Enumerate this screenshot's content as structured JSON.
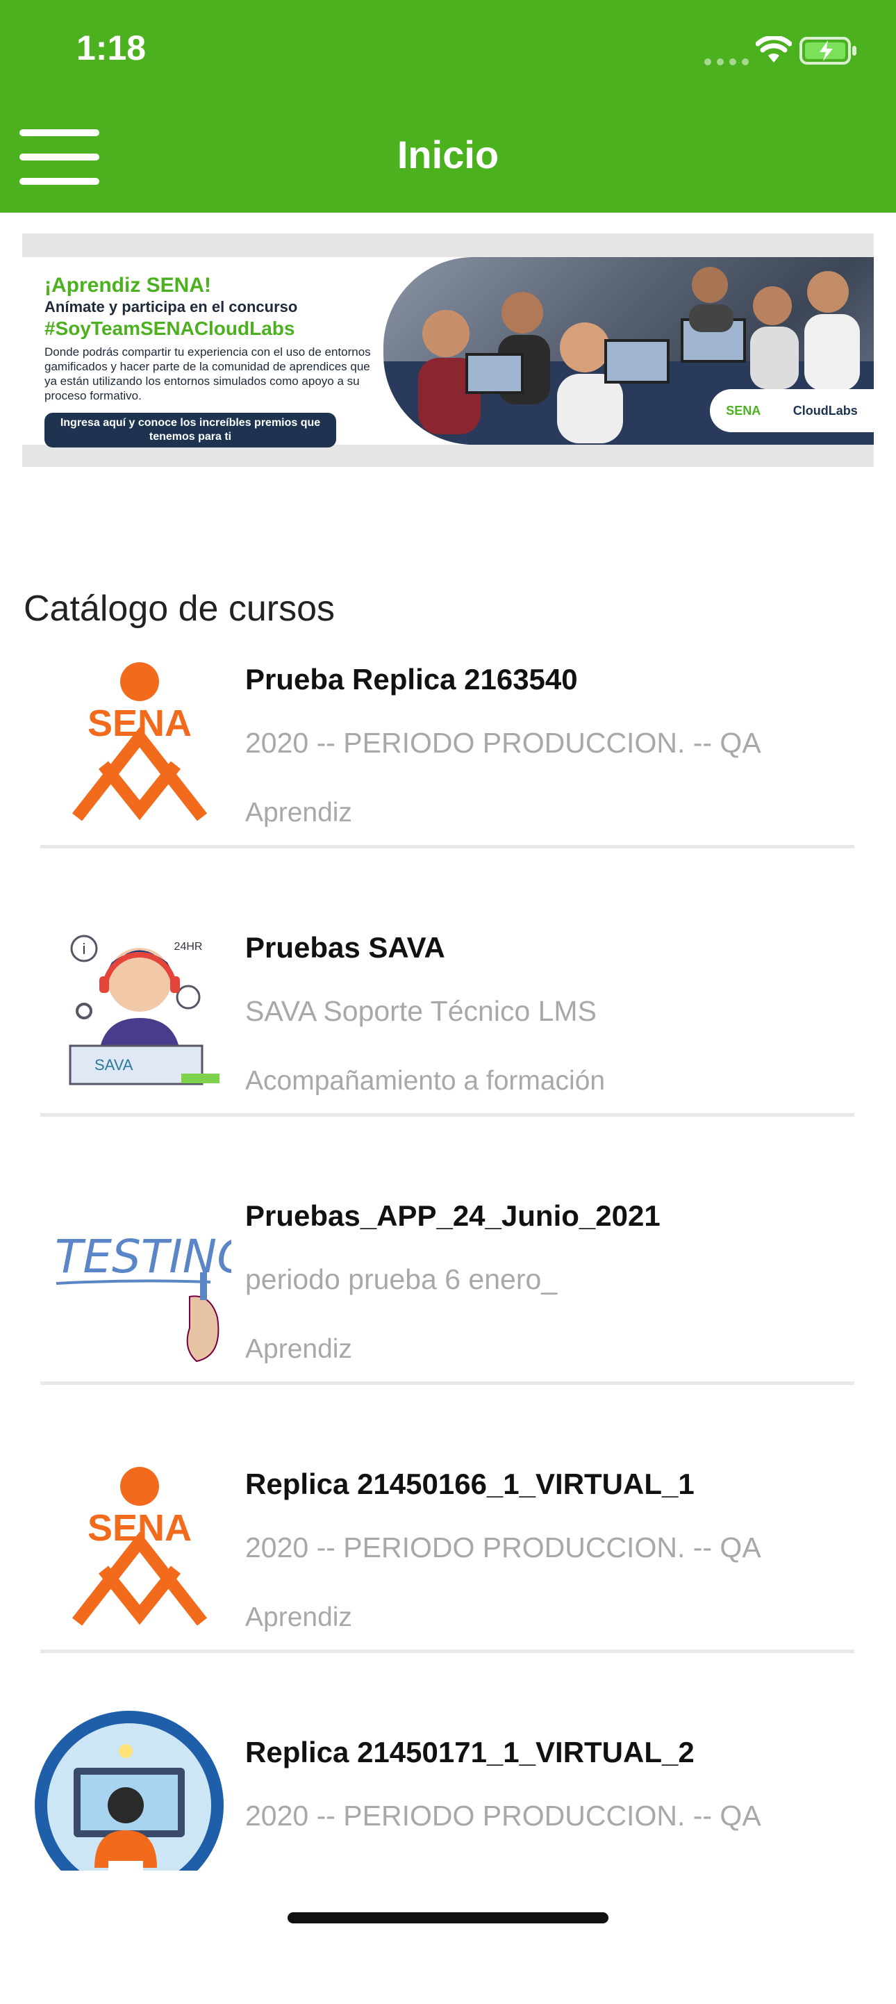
{
  "status_bar": {
    "time": "1:18"
  },
  "header": {
    "title": "Inicio"
  },
  "banner": {
    "title": "¡Aprendiz SENA!",
    "subtitle": "Anímate y participa en el concurso",
    "hashtag": "#SoyTeamSENACloudLabs",
    "description": "Donde podrás compartir tu experiencia con el uso de entornos gamificados y hacer parte de la comunidad de aprendices que ya están utilizando los entornos simulados como apoyo a su proceso formativo.",
    "cta": "Ingresa aquí y conoce los increíbles premios que tenemos para ti",
    "logo_sena": "SENA",
    "logo_cloudlabs": "CloudLabs"
  },
  "catalog": {
    "title": "Catálogo de cursos",
    "courses": [
      {
        "title": "Prueba Replica 2163540",
        "period": "2020 -- PERIODO PRODUCCION. -- QA",
        "role": "Aprendiz",
        "thumb": "sena-logo"
      },
      {
        "title": "Pruebas SAVA",
        "period": "SAVA Soporte Técnico LMS",
        "role": "Acompañamiento a formación",
        "thumb": "sava-support-illustration",
        "thumb_text": "SAVA",
        "thumb_badge": "24HR"
      },
      {
        "title": "Pruebas_APP_24_Junio_2021",
        "period": "periodo prueba 6 enero_",
        "role": "Aprendiz",
        "thumb": "testing-handwriting",
        "thumb_text": "TESTING"
      },
      {
        "title": "Replica 21450166_1_VIRTUAL_1",
        "period": "2020 -- PERIODO PRODUCCION. -- QA",
        "role": "Aprendiz",
        "thumb": "sena-logo"
      },
      {
        "title": "Replica 21450171_1_VIRTUAL_2",
        "period": "2020 -- PERIODO PRODUCCION. -- QA",
        "role": "",
        "thumb": "developer-illustration"
      }
    ]
  },
  "colors": {
    "header": "#4cb11e",
    "sena_orange": "#f26b1d",
    "muted_text": "#a8a8a8"
  }
}
